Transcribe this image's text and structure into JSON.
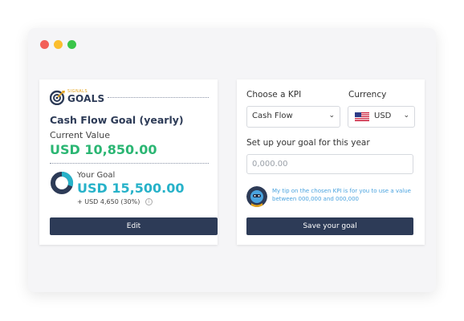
{
  "left_card": {
    "logo": {
      "small": "SIGNALS",
      "big": "GOALS"
    },
    "title": "Cash Flow Goal (yearly)",
    "current_label": "Current Value",
    "current_value": "USD 10,850.00",
    "your_goal_label": "Your Goal",
    "goal_value": "USD 15,500.00",
    "delta": "+ USD 4,650 (30%)",
    "info_icon": "i",
    "edit_label": "Edit"
  },
  "right_card": {
    "kpi_label": "Choose a KPI",
    "kpi_selected": "Cash Flow",
    "currency_label": "Currency",
    "currency_selected": "USD",
    "goal_label": "Set up your goal for this year",
    "goal_placeholder": "0,000.00",
    "tip": "My tip on the chosen KPI is for you to use a value between 000,000 and 000,000",
    "save_label": "Save your goal"
  },
  "colors": {
    "navy": "#2d3b57",
    "green": "#2bb673",
    "teal": "#27b2c9",
    "tip_blue": "#4aa3df"
  },
  "icons": [
    "close-dot",
    "minimize-dot",
    "maximize-dot",
    "target-logo-icon",
    "goal-ring-icon",
    "info-icon",
    "chevron-down-icon",
    "us-flag-icon",
    "assistant-avatar-icon"
  ]
}
